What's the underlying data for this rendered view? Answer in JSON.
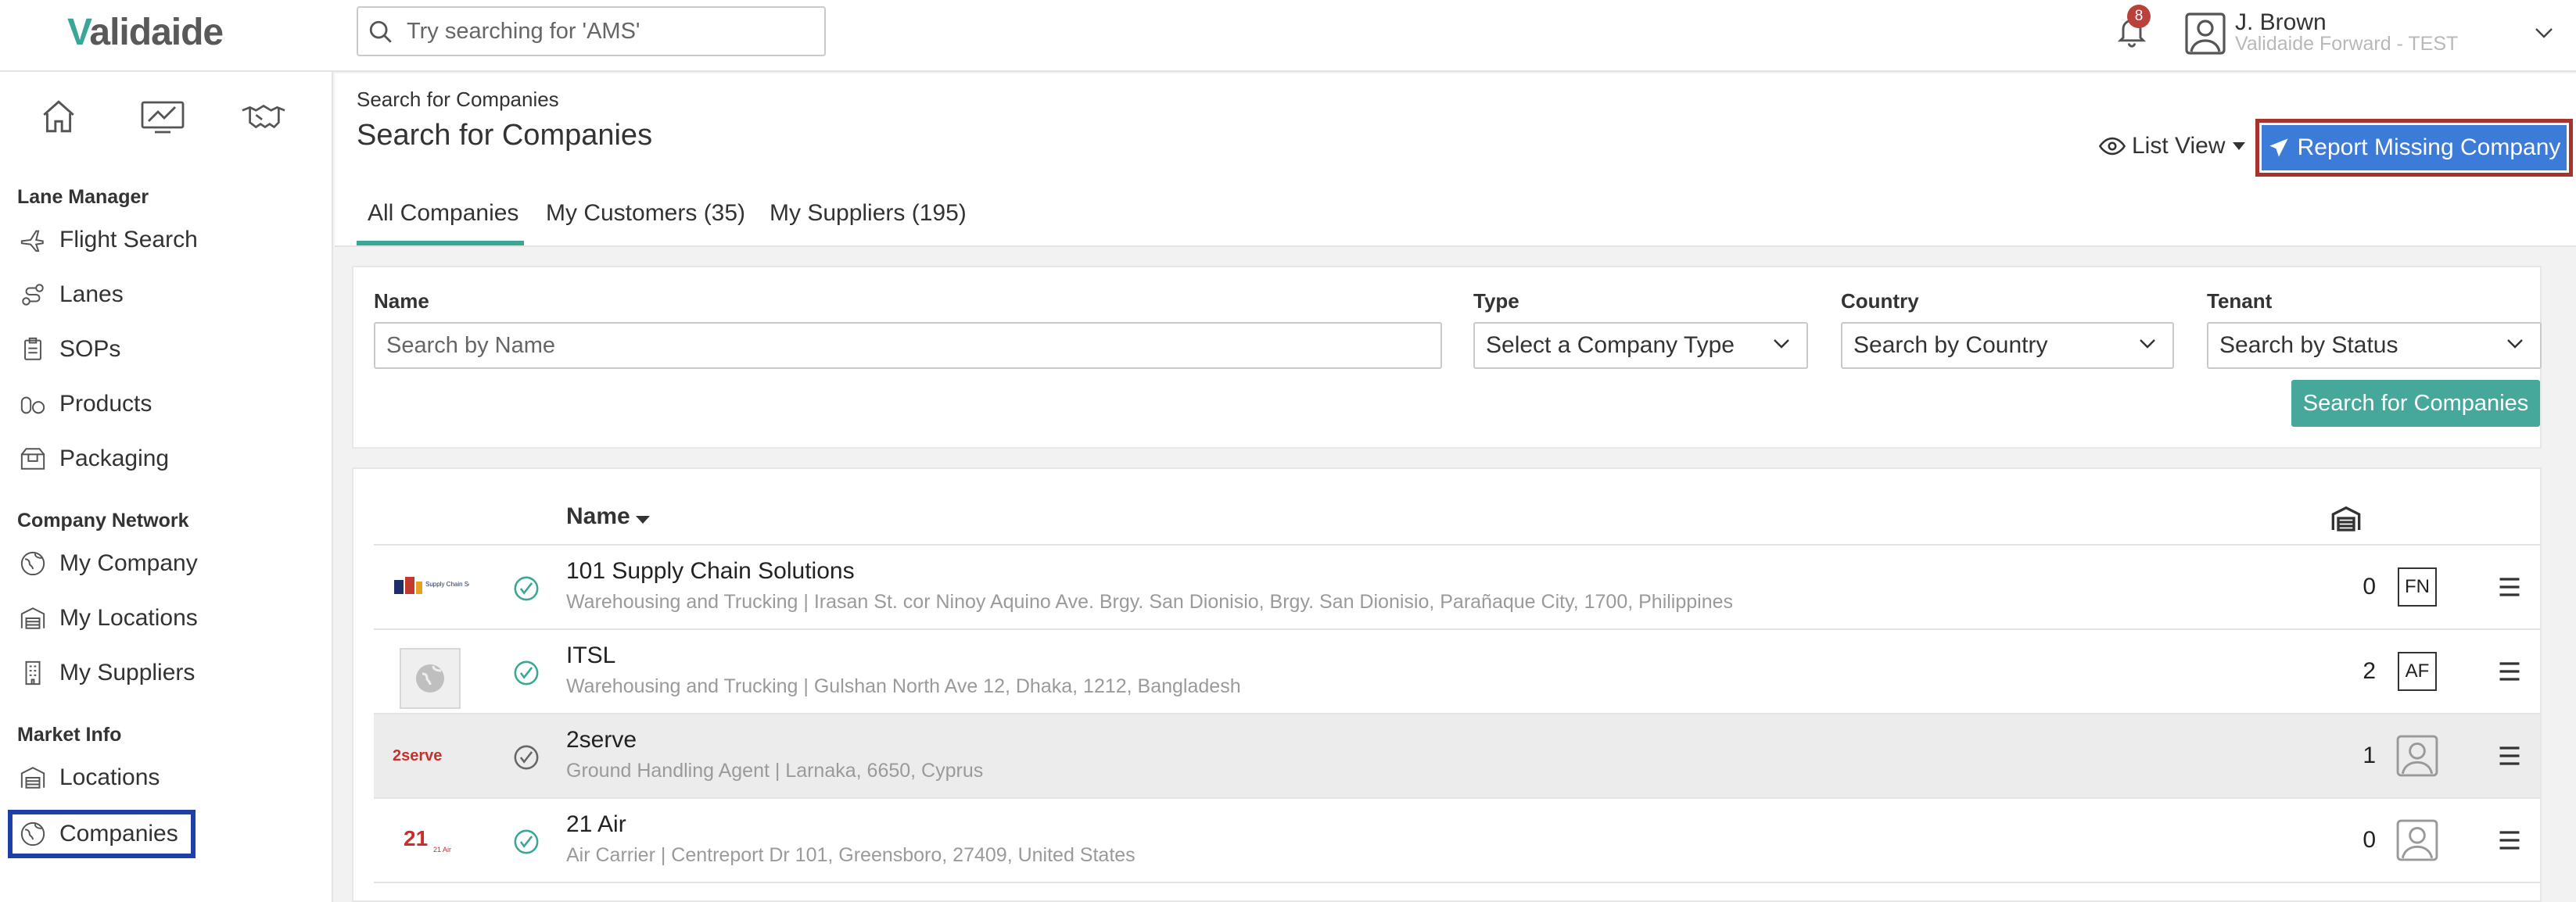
{
  "brand": {
    "logo_text_v": "V",
    "logo_text_rest": "alidaide",
    "accent": "#3aa796"
  },
  "topbar": {
    "search_placeholder": "Try searching for 'AMS'",
    "notifications_count": "8",
    "user_name": "J. Brown",
    "user_org": "Validaide Forward - TEST"
  },
  "sidebar": {
    "top_icons": [
      "home-icon",
      "chart-icon",
      "handshake-icon"
    ],
    "sections": [
      {
        "title": "Lane Manager",
        "items": [
          "Flight Search",
          "Lanes",
          "SOPs",
          "Products",
          "Packaging"
        ]
      },
      {
        "title": "Company Network",
        "items": [
          "My Company",
          "My Locations",
          "My Suppliers"
        ]
      },
      {
        "title": "Market Info",
        "items": [
          "Locations",
          "Companies"
        ]
      }
    ]
  },
  "page": {
    "breadcrumb": "Search for Companies",
    "title": "Search for Companies",
    "list_view_label": "List View",
    "report_button": "Report Missing Company",
    "report_color": "#3d7bd8",
    "tabs": [
      "All Companies",
      "My Customers (35)",
      "My Suppliers (195)"
    ]
  },
  "filters": {
    "name_label": "Name",
    "name_placeholder": "Search by Name",
    "type_label": "Type",
    "type_value": "Select a Company Type",
    "country_label": "Country",
    "country_value": "Search by Country",
    "tenant_label": "Tenant",
    "tenant_value": "Search by Status",
    "search_button": "Search for Companies"
  },
  "table": {
    "name_header": "Name",
    "rows": [
      {
        "name": "101 Supply Chain Solutions",
        "desc": "Warehousing and Trucking | Irasan St. cor Ninoy Aquino Ave. Brgy. San Dionisio, Brgy. San Dionisio, Parañaque City, 1700, Philippines",
        "count": "0",
        "tag": "FN",
        "verified": true
      },
      {
        "name": "ITSL",
        "desc": "Warehousing and Trucking | Gulshan North Ave 12, Dhaka, 1212, Bangladesh",
        "count": "2",
        "tag": "AF",
        "verified": true
      },
      {
        "name": "2serve",
        "desc": "Ground Handling Agent | Larnaka, 6650, Cyprus",
        "count": "1",
        "tag": "",
        "verified": false
      },
      {
        "name": "21 Air",
        "desc": "Air Carrier | Centreport Dr 101, Greensboro, 27409, United States",
        "count": "0",
        "tag": "",
        "verified": true
      }
    ],
    "logo_texts": [
      "Supply Chain Solutions Inc.",
      "2serve",
      "21 Air"
    ]
  }
}
